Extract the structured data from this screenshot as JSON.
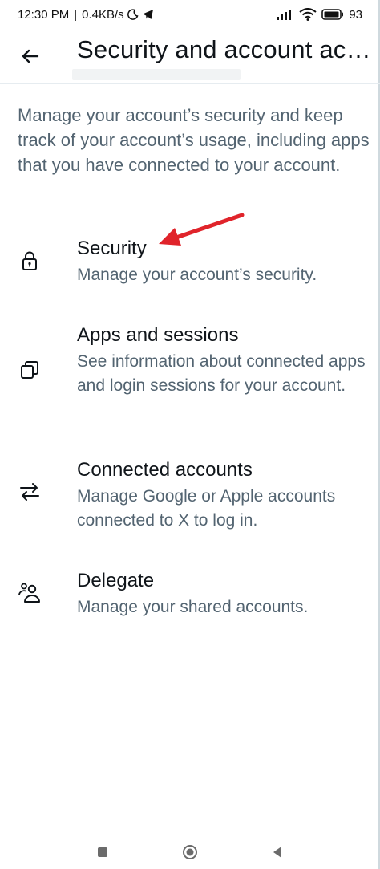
{
  "status_bar": {
    "time": "12:30 PM",
    "separator": "|",
    "speed": "0.4KB/s",
    "battery": "93"
  },
  "header": {
    "title": "Security and account access"
  },
  "intro": "Manage your account’s security and keep track of your account’s usage, including apps that you have connected to your account.",
  "items": [
    {
      "title": "Security",
      "description": "Manage your account’s security.",
      "icon": "lock-icon"
    },
    {
      "title": "Apps and sessions",
      "description": "See information about connected apps and login sessions for your account.",
      "icon": "copy-icon"
    },
    {
      "title": "Connected accounts",
      "description": "Manage Google or Apple accounts connected to X to log in.",
      "icon": "swap-arrows-icon"
    },
    {
      "title": "Delegate",
      "description": "Manage your shared accounts.",
      "icon": "people-icon"
    }
  ],
  "colors": {
    "text_primary": "#0f1419",
    "text_secondary": "#536471",
    "annotation_arrow": "#e0242b"
  },
  "nav": {
    "icons": [
      "recents-square-icon",
      "home-circle-icon",
      "back-triangle-icon"
    ]
  }
}
